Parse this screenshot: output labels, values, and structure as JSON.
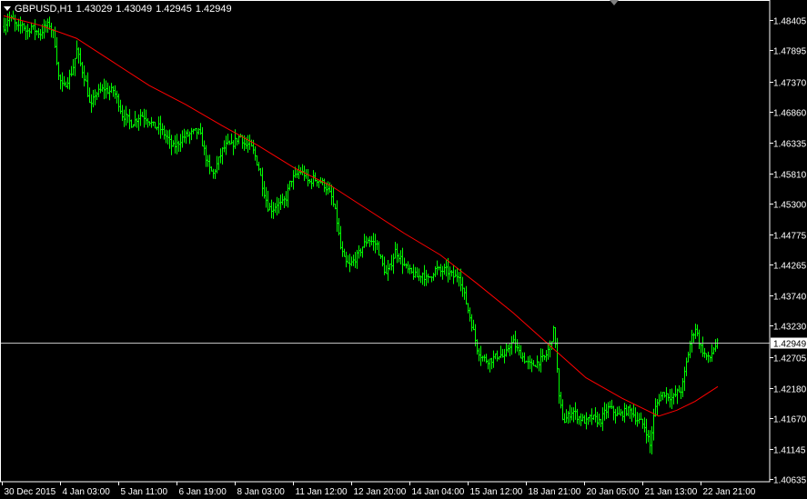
{
  "header": {
    "symbol": "GBPUSD,H1",
    "open": "1.43029",
    "high": "1.43049",
    "low": "1.42945",
    "close": "1.42949"
  },
  "colors": {
    "background": "#000000",
    "bars": "#00ff00",
    "moving_average": "#ff0000",
    "axis": "#ffffff",
    "bid_line": "#c0c0c0",
    "price_tag_bg": "#ffffff"
  },
  "chart_data": {
    "type": "ohlc",
    "symbol": "GBPUSD",
    "timeframe": "H1",
    "y_ticks": [
      "1.48405",
      "1.47895",
      "1.47370",
      "1.46860",
      "1.46335",
      "1.45810",
      "1.45300",
      "1.44775",
      "1.44265",
      "1.43740",
      "1.43230",
      "1.42705",
      "1.42180",
      "1.41670",
      "1.41145",
      "1.40635"
    ],
    "ylim": [
      1.40635,
      1.48625
    ],
    "x_ticks": [
      "30 Dec 2015",
      "4 Jan 03:00",
      "5 Jan 11:00",
      "6 Jan 19:00",
      "8 Jan 03:00",
      "11 Jan 12:00",
      "12 Jan 20:00",
      "14 Jan 04:00",
      "15 Jan 12:00",
      "18 Jan 21:00",
      "20 Jan 05:00",
      "21 Jan 13:00",
      "22 Jan 21:00"
    ],
    "current_price": "1.42949",
    "close_path": [
      [
        0,
        1.483
      ],
      [
        5,
        1.4845
      ],
      [
        10,
        1.484
      ],
      [
        15,
        1.4825
      ],
      [
        20,
        1.4835
      ],
      [
        25,
        1.482
      ],
      [
        30,
        1.483
      ],
      [
        35,
        1.4822
      ],
      [
        40,
        1.4818
      ],
      [
        45,
        1.483
      ],
      [
        50,
        1.4833
      ],
      [
        55,
        1.4815
      ],
      [
        60,
        1.4745
      ],
      [
        65,
        1.4725
      ],
      [
        70,
        1.474
      ],
      [
        75,
        1.4755
      ],
      [
        80,
        1.479
      ],
      [
        85,
        1.476
      ],
      [
        90,
        1.4735
      ],
      [
        95,
        1.469
      ],
      [
        100,
        1.4715
      ],
      [
        105,
        1.472
      ],
      [
        110,
        1.4725
      ],
      [
        115,
        1.472
      ],
      [
        120,
        1.4722
      ],
      [
        125,
        1.4705
      ],
      [
        130,
        1.468
      ],
      [
        135,
        1.4675
      ],
      [
        140,
        1.4665
      ],
      [
        145,
        1.4672
      ],
      [
        150,
        1.468
      ],
      [
        155,
        1.4677
      ],
      [
        160,
        1.467
      ],
      [
        165,
        1.466
      ],
      [
        170,
        1.466
      ],
      [
        175,
        1.465
      ],
      [
        180,
        1.464
      ],
      [
        185,
        1.4625
      ],
      [
        190,
        1.463
      ],
      [
        195,
        1.464
      ],
      [
        200,
        1.4645
      ],
      [
        205,
        1.4648
      ],
      [
        210,
        1.4652
      ],
      [
        215,
        1.465
      ],
      [
        220,
        1.462
      ],
      [
        225,
        1.459
      ],
      [
        230,
        1.458
      ],
      [
        235,
        1.46
      ],
      [
        240,
        1.462
      ],
      [
        245,
        1.463
      ],
      [
        250,
        1.4628
      ],
      [
        255,
        1.4638
      ],
      [
        260,
        1.4645
      ],
      [
        265,
        1.4628
      ],
      [
        270,
        1.463
      ],
      [
        275,
        1.4615
      ],
      [
        280,
        1.459
      ],
      [
        285,
        1.4555
      ],
      [
        290,
        1.4525
      ],
      [
        295,
        1.452
      ],
      [
        300,
        1.453
      ],
      [
        305,
        1.4528
      ],
      [
        310,
        1.454
      ],
      [
        315,
        1.457
      ],
      [
        320,
        1.4575
      ],
      [
        325,
        1.4585
      ],
      [
        330,
        1.458
      ],
      [
        335,
        1.4565
      ],
      [
        340,
        1.4572
      ],
      [
        345,
        1.457
      ],
      [
        350,
        1.4565
      ],
      [
        355,
        1.4555
      ],
      [
        360,
        1.454
      ],
      [
        365,
        1.451
      ],
      [
        370,
        1.4455
      ],
      [
        375,
        1.443
      ],
      [
        380,
        1.4425
      ],
      [
        385,
        1.4435
      ],
      [
        390,
        1.4445
      ],
      [
        395,
        1.446
      ],
      [
        400,
        1.447
      ],
      [
        405,
        1.4465
      ],
      [
        410,
        1.446
      ],
      [
        415,
        1.443
      ],
      [
        420,
        1.441
      ],
      [
        425,
        1.4425
      ],
      [
        430,
        1.445
      ],
      [
        435,
        1.444
      ],
      [
        440,
        1.4425
      ],
      [
        445,
        1.4415
      ],
      [
        450,
        1.441
      ],
      [
        455,
        1.4405
      ],
      [
        460,
        1.4412
      ],
      [
        465,
        1.44
      ],
      [
        470,
        1.441
      ],
      [
        475,
        1.442
      ],
      [
        480,
        1.4415
      ],
      [
        485,
        1.4418
      ],
      [
        490,
        1.4412
      ],
      [
        495,
        1.4405
      ],
      [
        500,
        1.441
      ],
      [
        505,
        1.438
      ],
      [
        510,
        1.435
      ],
      [
        515,
        1.432
      ],
      [
        520,
        1.4285
      ],
      [
        525,
        1.427
      ],
      [
        530,
        1.4265
      ],
      [
        535,
        1.4265
      ],
      [
        540,
        1.427
      ],
      [
        545,
        1.4275
      ],
      [
        550,
        1.4268
      ],
      [
        555,
        1.429
      ],
      [
        560,
        1.4295
      ],
      [
        565,
        1.428
      ],
      [
        570,
        1.427
      ],
      [
        575,
        1.426
      ],
      [
        580,
        1.4255
      ],
      [
        585,
        1.426
      ],
      [
        590,
        1.4265
      ],
      [
        595,
        1.427
      ],
      [
        600,
        1.429
      ],
      [
        605,
        1.432
      ],
      [
        610,
        1.42
      ],
      [
        615,
        1.416
      ],
      [
        620,
        1.417
      ],
      [
        625,
        1.418
      ],
      [
        630,
        1.417
      ],
      [
        635,
        1.4165
      ],
      [
        640,
        1.416
      ],
      [
        645,
        1.4168
      ],
      [
        650,
        1.4165
      ],
      [
        655,
        1.416
      ],
      [
        660,
        1.4175
      ],
      [
        665,
        1.4185
      ],
      [
        670,
        1.4178
      ],
      [
        675,
        1.417
      ],
      [
        680,
        1.4175
      ],
      [
        685,
        1.418
      ],
      [
        690,
        1.4178
      ],
      [
        695,
        1.4165
      ],
      [
        700,
        1.416
      ],
      [
        705,
        1.415
      ],
      [
        710,
        1.412
      ],
      [
        715,
        1.418
      ],
      [
        720,
        1.42
      ],
      [
        725,
        1.421
      ],
      [
        730,
        1.4205
      ],
      [
        735,
        1.42
      ],
      [
        740,
        1.421
      ],
      [
        745,
        1.4215
      ],
      [
        750,
        1.426
      ],
      [
        755,
        1.43
      ],
      [
        760,
        1.432
      ],
      [
        765,
        1.429
      ],
      [
        770,
        1.4275
      ],
      [
        775,
        1.4265
      ],
      [
        780,
        1.4285
      ],
      [
        785,
        1.4295
      ]
    ],
    "moving_average": [
      [
        0,
        1.4848
      ],
      [
        40,
        1.4832
      ],
      [
        80,
        1.481
      ],
      [
        120,
        1.477
      ],
      [
        160,
        1.473
      ],
      [
        200,
        1.4698
      ],
      [
        240,
        1.4662
      ],
      [
        280,
        1.4628
      ],
      [
        320,
        1.459
      ],
      [
        360,
        1.456
      ],
      [
        400,
        1.452
      ],
      [
        440,
        1.448
      ],
      [
        480,
        1.4443
      ],
      [
        520,
        1.4395
      ],
      [
        560,
        1.4345
      ],
      [
        600,
        1.429
      ],
      [
        640,
        1.4235
      ],
      [
        680,
        1.42
      ],
      [
        700,
        1.4185
      ],
      [
        720,
        1.417
      ],
      [
        740,
        1.418
      ],
      [
        760,
        1.4195
      ],
      [
        785,
        1.422
      ]
    ]
  }
}
